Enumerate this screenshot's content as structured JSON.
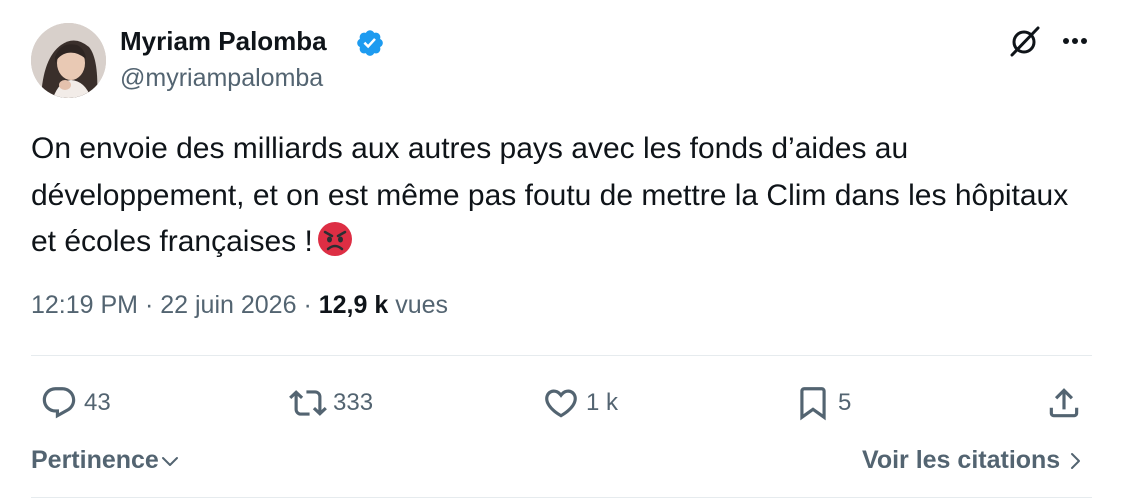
{
  "tweet": {
    "author_name": "Myriam Palomba",
    "author_handle": "@myriampalomba",
    "verified_badge_color": "#1d9bf0",
    "text": "On envoie des milliards aux autres pays avec les fonds d’aides au développement, et on est même pas foutu de mettre la Clim dans les hôpitaux et écoles françaises !",
    "emoji": "angry-face-icon",
    "time": "12:19 PM",
    "separator": "·",
    "date": "22 juin 2026",
    "views_count": "12,9 k",
    "views_label": "vues"
  },
  "actions": {
    "replies": "43",
    "reposts": "333",
    "likes": "1 k",
    "bookmarks": "5"
  },
  "footer": {
    "sort_label": "Pertinence",
    "quotes_label": "Voir les citations"
  },
  "colors": {
    "text": "#0f1419",
    "secondary": "#536471",
    "accent": "#1d9bf0",
    "divider": "#e6ebee"
  }
}
